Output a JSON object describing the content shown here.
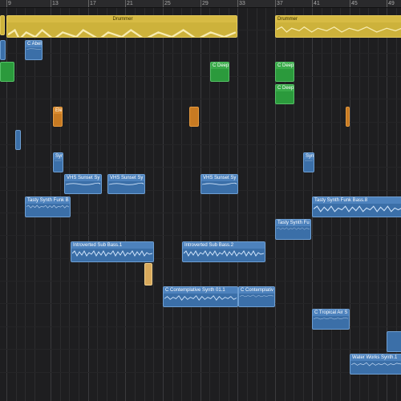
{
  "ruler": {
    "bars": [
      "9",
      "13",
      "17",
      "21",
      "25",
      "29",
      "33",
      "37",
      "41",
      "45",
      "49"
    ]
  },
  "regions": {
    "drummer_1": {
      "label": "Drummer"
    },
    "drummer_2": {
      "label": "Drummer"
    },
    "abel": {
      "label": "C Abel"
    },
    "deep_1": {
      "label": "C Deep"
    },
    "deep_2": {
      "label": "C Deep"
    },
    "deep_3": {
      "label": "C Deep"
    },
    "ele_1": {
      "label": "Ele"
    },
    "syn_1": {
      "label": "Syn"
    },
    "syn_2": {
      "label": "Syn"
    },
    "vhs_1": {
      "label": "VHS Sunset Sy"
    },
    "vhs_2": {
      "label": "VHS Sunset Sy"
    },
    "vhs_3": {
      "label": "VHS Sunset Sy"
    },
    "tasty_1": {
      "label": "Tasty Synth Funk B"
    },
    "tasty_2": {
      "label": "Tasty Synth Funk Bass.8"
    },
    "tasty_3": {
      "label": "Tasty Synth Fu"
    },
    "intro_1": {
      "label": "Introverted Sub Bass.1"
    },
    "intro_2": {
      "label": "Introverted Sub Bass.2"
    },
    "contemp_1": {
      "label": "C Contemplative Synth 01.1"
    },
    "contemp_2": {
      "label": "C Contemplativ"
    },
    "tropical": {
      "label": "C Tropical Air S"
    },
    "waterworks": {
      "label": "Water Works Synth.1"
    }
  },
  "colors": {
    "audio": "#3b6fa8",
    "drummer": "#cdb23b",
    "midi_green": "#2b9a3c",
    "orange": "#c77a22",
    "background": "#1e1e20"
  }
}
